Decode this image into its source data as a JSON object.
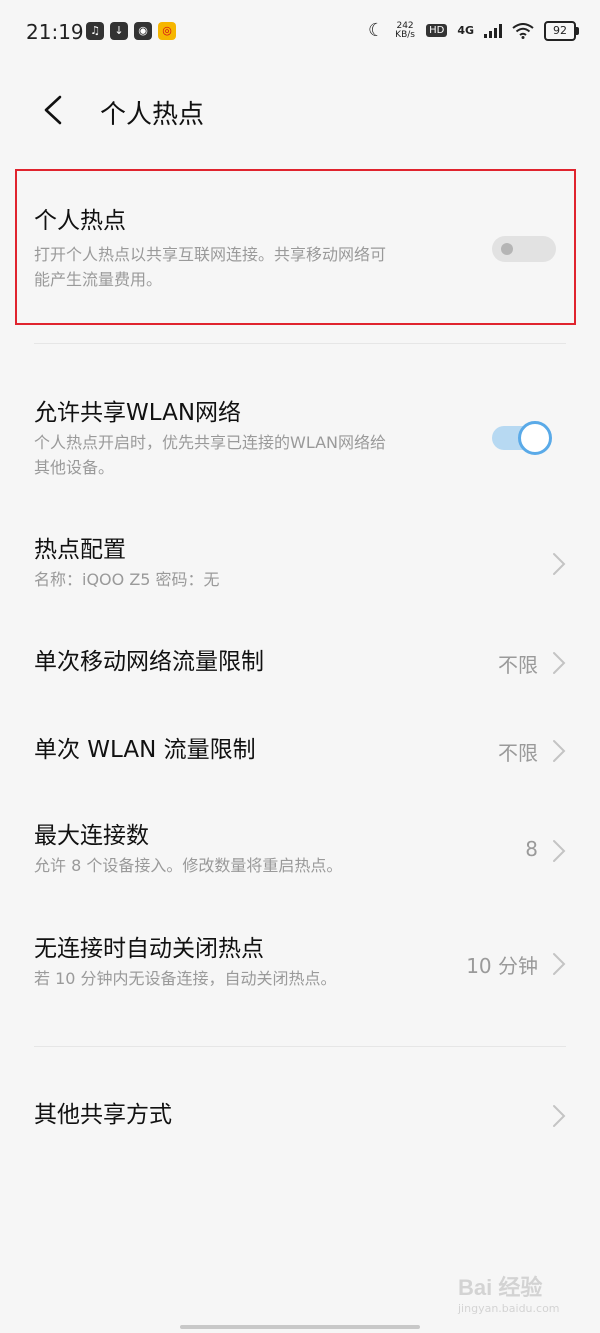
{
  "status_bar": {
    "time": "21:19",
    "net_speed_value": "242",
    "net_speed_unit": "KB/s",
    "hd_badge": "HD",
    "network_type": "4G",
    "battery": "92"
  },
  "header": {
    "title": "个人热点"
  },
  "settings": {
    "hotspot": {
      "title": "个人热点",
      "desc_line1": "打开个人热点以共享互联网连接。共享移动网络可",
      "desc_line2": "能产生流量费用。",
      "enabled": false
    },
    "share_wlan": {
      "title": "允许共享WLAN网络",
      "desc_line1": "个人热点开启时，优先共享已连接的WLAN网络给",
      "desc_line2": "其他设备。",
      "enabled": true
    },
    "config": {
      "title": "热点配置",
      "desc": "名称：iQOO  Z5    密码：无"
    },
    "mobile_limit": {
      "title": "单次移动网络流量限制",
      "value": "不限"
    },
    "wlan_limit": {
      "title": "单次  WLAN  流量限制",
      "value": "不限"
    },
    "max_connections": {
      "title": "最大连接数",
      "desc": "允许  8  个设备接入。修改数量将重启热点。",
      "value": "8"
    },
    "auto_off": {
      "title": "无连接时自动关闭热点",
      "desc": "若  10  分钟内无设备连接，自动关闭热点。",
      "value": "10  分钟"
    },
    "other_sharing": {
      "title": "其他共享方式"
    }
  },
  "colors": {
    "highlight_border": "#e0242e",
    "toggle_on": "#5aaae8",
    "background": "#f6f6f6"
  },
  "watermark": {
    "brand": "Bai 经验",
    "url": "jingyan.baidu.com"
  }
}
